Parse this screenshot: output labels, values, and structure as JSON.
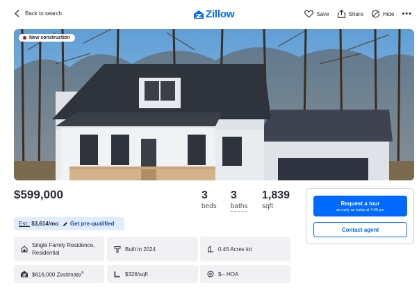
{
  "header": {
    "back_label": "Back to search",
    "logo_text": "Zillow",
    "save_label": "Save",
    "share_label": "Share",
    "hide_label": "Hide",
    "more_label": "•••"
  },
  "photo": {
    "badge": "New construction"
  },
  "listing": {
    "price": "$599,000",
    "beds": "3",
    "beds_label": "beds",
    "baths": "3",
    "baths_label": "baths",
    "sqft": "1,839",
    "sqft_label": "sqft"
  },
  "estimate": {
    "label": "Est.:",
    "amount": "$3,614/mo",
    "prequal": "Get pre-qualified"
  },
  "facts": {
    "type_line1": "Single Family Residence,",
    "type_line2": "Residential",
    "built": "Built in 2024",
    "lot": "0.45 Acres lot",
    "zestimate": "$616,000 Zestimate",
    "zestimate_mark": "®",
    "price_sqft": "$326/sqft",
    "hoa": "$-- HOA"
  },
  "contact": {
    "tour_title": "Request a tour",
    "tour_sub": "as early as today at 4:00 pm",
    "agent": "Contact agent"
  },
  "colors": {
    "brand": "#006aff",
    "badge_dot": "#d0021b",
    "estimate_bg": "#e0ecff",
    "tile_bg": "#f1f1f4"
  },
  "icons": [
    "chevron-left-icon",
    "zillow-logo-icon",
    "heart-icon",
    "share-icon",
    "hide-icon",
    "more-icon",
    "pencil-icon",
    "house-type-icon",
    "hammer-icon",
    "lot-icon",
    "zestimate-icon",
    "ruler-icon",
    "hoa-icon"
  ]
}
